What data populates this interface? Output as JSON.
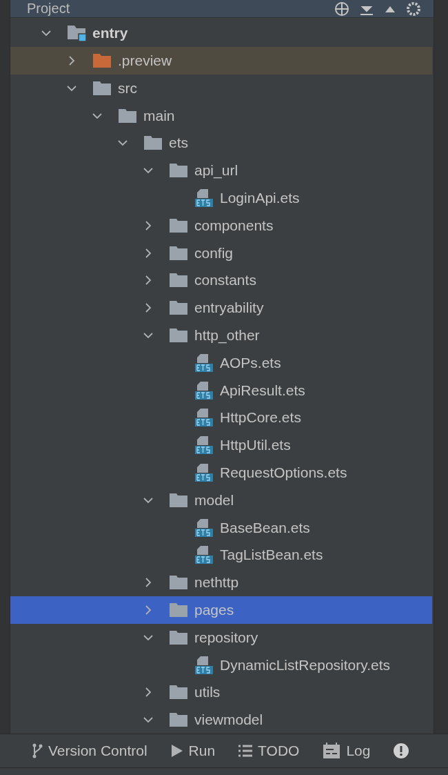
{
  "panel": {
    "title": "Project"
  },
  "tree": [
    {
      "name": "entry",
      "kind": "module",
      "expanded": true,
      "selected": false,
      "children": [
        {
          "name": ".preview",
          "kind": "excluded",
          "expanded": false,
          "selected": false
        },
        {
          "name": "src",
          "kind": "folder",
          "expanded": true,
          "selected": false,
          "children": [
            {
              "name": "main",
              "kind": "folder",
              "expanded": true,
              "selected": false,
              "children": [
                {
                  "name": "ets",
                  "kind": "folder",
                  "expanded": true,
                  "selected": false,
                  "children": [
                    {
                      "name": "api_url",
                      "kind": "folder",
                      "expanded": true,
                      "selected": false,
                      "children": [
                        {
                          "name": "LoginApi.ets",
                          "kind": "file",
                          "selected": false
                        }
                      ]
                    },
                    {
                      "name": "components",
                      "kind": "folder",
                      "expanded": false,
                      "selected": false
                    },
                    {
                      "name": "config",
                      "kind": "folder",
                      "expanded": false,
                      "selected": false
                    },
                    {
                      "name": "constants",
                      "kind": "folder",
                      "expanded": false,
                      "selected": false
                    },
                    {
                      "name": "entryability",
                      "kind": "folder",
                      "expanded": false,
                      "selected": false
                    },
                    {
                      "name": "http_other",
                      "kind": "folder",
                      "expanded": true,
                      "selected": false,
                      "children": [
                        {
                          "name": "AOPs.ets",
                          "kind": "file",
                          "selected": false
                        },
                        {
                          "name": "ApiResult.ets",
                          "kind": "file",
                          "selected": false
                        },
                        {
                          "name": "HttpCore.ets",
                          "kind": "file",
                          "selected": false
                        },
                        {
                          "name": "HttpUtil.ets",
                          "kind": "file",
                          "selected": false
                        },
                        {
                          "name": "RequestOptions.ets",
                          "kind": "file",
                          "selected": false
                        }
                      ]
                    },
                    {
                      "name": "model",
                      "kind": "folder",
                      "expanded": true,
                      "selected": false,
                      "children": [
                        {
                          "name": "BaseBean.ets",
                          "kind": "file",
                          "selected": false
                        },
                        {
                          "name": "TagListBean.ets",
                          "kind": "file",
                          "selected": false
                        }
                      ]
                    },
                    {
                      "name": "nethttp",
                      "kind": "folder",
                      "expanded": false,
                      "selected": false
                    },
                    {
                      "name": "pages",
                      "kind": "folder",
                      "expanded": false,
                      "selected": true
                    },
                    {
                      "name": "repository",
                      "kind": "folder",
                      "expanded": true,
                      "selected": false,
                      "children": [
                        {
                          "name": "DynamicListRepository.ets",
                          "kind": "file",
                          "selected": false
                        }
                      ]
                    },
                    {
                      "name": "utils",
                      "kind": "folder",
                      "expanded": false,
                      "selected": false
                    },
                    {
                      "name": "viewmodel",
                      "kind": "folder",
                      "expanded": true,
                      "selected": false
                    }
                  ]
                }
              ]
            }
          ]
        }
      ]
    }
  ],
  "tool_windows": [
    {
      "label": "Version Control",
      "kind": "vcs"
    },
    {
      "label": "Run",
      "kind": "run"
    },
    {
      "label": "TODO",
      "kind": "todo"
    },
    {
      "label": "Log",
      "kind": "log"
    },
    {
      "kind": "problems"
    }
  ]
}
